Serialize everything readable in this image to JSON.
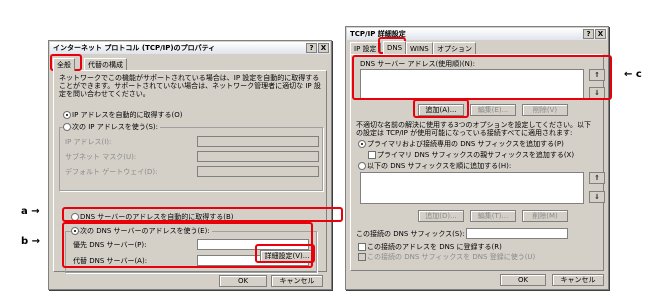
{
  "dialog1": {
    "title": "インターネット プロトコル (TCP/IP)のプロパティ",
    "help": "?",
    "close": "X",
    "tabs": [
      "全般",
      "代替の構成"
    ],
    "intro": "ネットワークでこの機能がサポートされている場合は、IP 設定を自動的に取得することができます。サポートされていない場合は、ネットワーク管理者に適切な IP 設定を問い合わせてください。",
    "ip_auto": "IP アドレスを自動的に取得する(O)",
    "ip_manual": "次の IP アドレスを使う(S):",
    "ip_address_label": "IP アドレス(I):",
    "subnet_label": "サブネット マスク(U):",
    "gateway_label": "デフォルト ゲートウェイ(D):",
    "dns_auto": "DNS サーバーのアドレスを自動的に取得する(B)",
    "dns_manual": "次の DNS サーバーのアドレスを使う(E):",
    "preferred_dns_label": "優先 DNS サーバー(P):",
    "alternate_dns_label": "代替 DNS サーバー(A):",
    "advanced_button": "詳細設定(V)...",
    "ok": "OK",
    "cancel": "キャンセル"
  },
  "dialog2": {
    "title": "TCP/IP 詳細設定",
    "help": "?",
    "close": "X",
    "tabs": [
      "IP 設定",
      "DNS",
      "WINS",
      "オプション"
    ],
    "dns_list_label": "DNS サーバー アドレス(使用順)(N):",
    "add_button": "追加(A)...",
    "edit_button": "編集(E)...",
    "delete_button": "削除(V)",
    "suffix_intro": "不適切な名前の解決に使用する3つのオプションを設定してください。以下の設定は TCP/IP が使用可能になっている接続すべてに適用されます:",
    "primary_suffix": "プライマリおよび接続専用の DNS サフィックスを追加する(P)",
    "parent_suffix": "プライマリ DNS サフィックスの親サフィックスを追加する(X)",
    "these_suffixes": "以下の DNS サフィックスを順に追加する(H):",
    "add_button2": "追加(D)...",
    "edit_button2": "編集(T)...",
    "delete_button2": "削除(M)",
    "conn_suffix_label": "この接続の DNS サフィックス(S):",
    "register_addr": "この接続のアドレスを DNS に登録する(R)",
    "use_suffix": "この接続の DNS サフィックスを DNS 登録に使う(U)",
    "ok": "OK",
    "cancel": "キャンセル",
    "up_arrow": "⇑",
    "down_arrow": "⇓"
  },
  "annotations": {
    "a": "a →",
    "b": "b →",
    "c": "← c"
  },
  "colors": {
    "highlight": "#e8000b",
    "dialog_bg": "#d4d0c8"
  }
}
